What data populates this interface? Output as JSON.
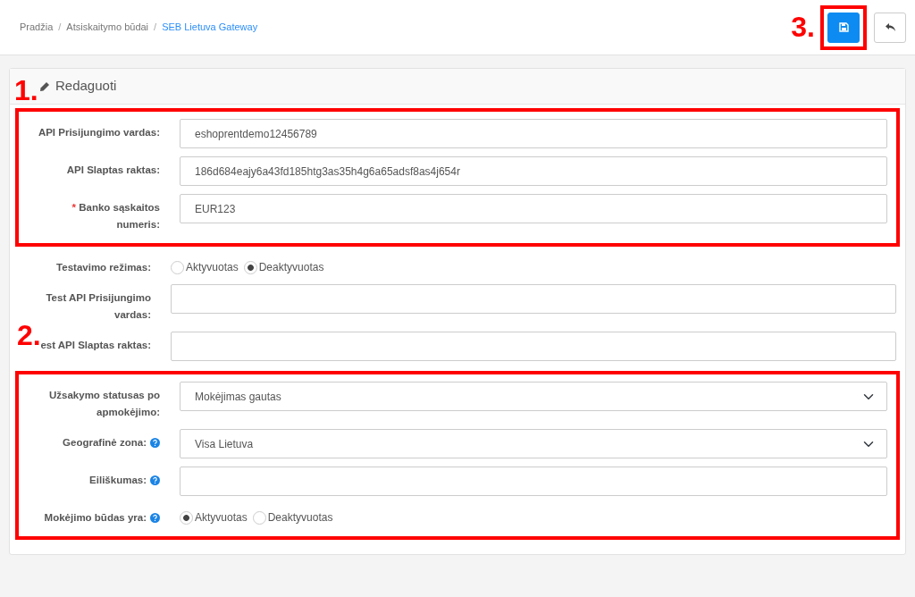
{
  "breadcrumb": [
    {
      "label": "Pradžia",
      "selected": false
    },
    {
      "separator": "/",
      "label": "Atsiskaitymo būdai",
      "selected": false
    },
    {
      "separator": "/",
      "label": "SEB Lietuva Gateway",
      "selected": true
    }
  ],
  "toolbar_buttons": [
    {
      "kind": "save",
      "annotation": "3."
    },
    {
      "kind": "back"
    }
  ],
  "card": {
    "title": "Redaguoti",
    "annotation": "1."
  },
  "sections": [
    {
      "framed": true,
      "fields": [
        {
          "kind": "text",
          "label": "API Prisijungimo vardas:",
          "value": "eshoprentdemo12456789",
          "help": false
        },
        {
          "kind": "text",
          "label": "API Slaptas raktas:",
          "value": "186d684eajy6a43fd185htg3as35h4g6a65adsf8as4j654r",
          "help": false
        },
        {
          "kind": "text",
          "required_mark": "*",
          "label": "Banko sąskaitos numeris:",
          "value": "EUR123",
          "help": false
        }
      ]
    },
    {
      "framed": false,
      "fields": [
        {
          "kind": "radio",
          "label": "Testavimo režimas:",
          "help": false,
          "options": [
            {
              "label": "Aktyvuotas",
              "selected": false
            },
            {
              "label": "Deaktyvuotas",
              "selected": true
            }
          ]
        },
        {
          "kind": "text",
          "label": "Test API Prisijungimo vardas:",
          "help": false
        },
        {
          "kind": "text",
          "label": "est API Slaptas raktas:",
          "help": false,
          "annotation": "2."
        }
      ]
    },
    {
      "framed": true,
      "fields": [
        {
          "kind": "select",
          "label": "Užsakymo statusas po apmokėjimo:",
          "value": "Mokėjimas gautas",
          "help": false
        },
        {
          "kind": "select",
          "label": "Geografinė zona:",
          "value": "Visa Lietuva",
          "help": true
        },
        {
          "kind": "text",
          "label": "Eiliškumas:",
          "help": true
        },
        {
          "kind": "radio",
          "label": "Mokėjimo būdas yra:",
          "help": true,
          "options": [
            {
              "label": "Aktyvuotas",
              "selected": true
            },
            {
              "label": "Deaktyvuotas",
              "selected": false
            }
          ]
        }
      ]
    }
  ]
}
